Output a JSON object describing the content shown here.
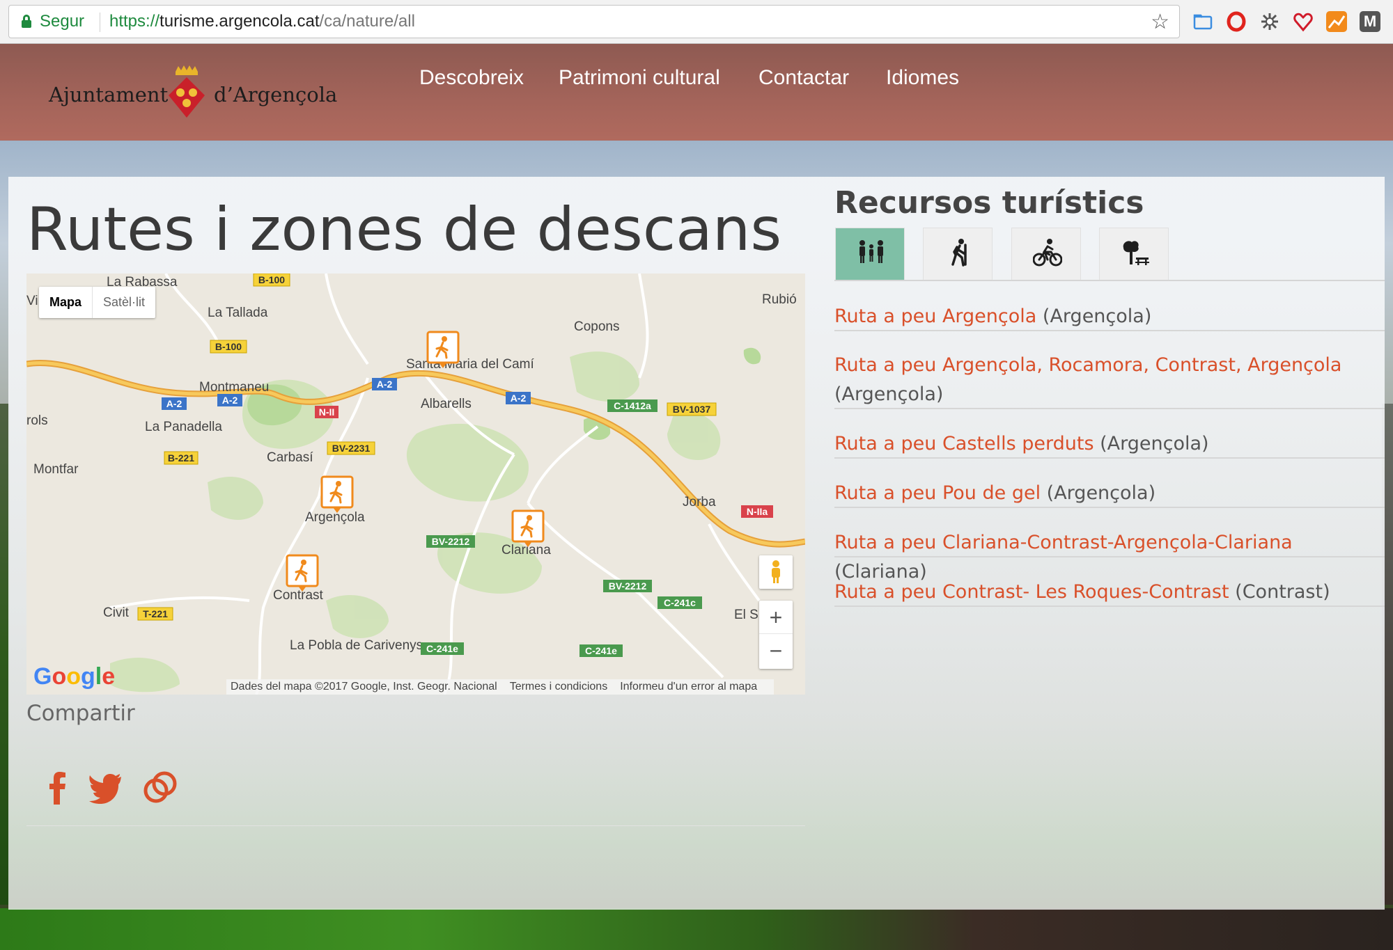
{
  "browser": {
    "secure_label": "Segur",
    "url_scheme": "https://",
    "url_host": "turisme.argencola.cat",
    "url_path": "/ca/nature/all",
    "bookmark_icon": "star-icon",
    "extensions": [
      "folder-icon",
      "opera-icon",
      "gear-icon",
      "heart-icon",
      "chart-icon",
      "gmail-icon"
    ]
  },
  "header": {
    "logo_left": "Ajuntament",
    "logo_right": "d’Argençola",
    "nav": [
      "Descobreix",
      "Patrimoni cultural",
      "Contactar",
      "Idiomes"
    ]
  },
  "page": {
    "title": "Rutes i zones de descans"
  },
  "map": {
    "type_buttons": {
      "active": "Mapa",
      "inactive": "Satèl·lit"
    },
    "labels": [
      "La Rabassa",
      "La Tallada",
      "Montmaneu",
      "La Panadella",
      "Carbasí",
      "Montfar",
      "Argençola",
      "Santa Maria del Camí",
      "Albarells",
      "Copons",
      "Rubió",
      "Jorba",
      "Clariana",
      "Contrast",
      "Civit",
      "La Pobla de Carivenys",
      "El S",
      "rols",
      "Vi"
    ],
    "road_labels": [
      "B-100",
      "B-100",
      "A-2",
      "A-2",
      "A-2",
      "A-2",
      "N-II",
      "B-221",
      "BV-2231",
      "BV-2212",
      "BV-2212",
      "C-1412a",
      "BV-1037",
      "N-IIa",
      "C-241c",
      "C-241e",
      "C-241e",
      "T-221"
    ],
    "attribution": [
      "Dades del mapa ©2017 Google, Inst. Geogr. Nacional",
      "Termes i condicions",
      "Informeu d'un error al mapa"
    ],
    "logo": "Google",
    "zoom_in": "+",
    "zoom_out": "−"
  },
  "share": {
    "title": "Compartir",
    "icons": [
      "facebook-icon",
      "twitter-icon",
      "link-icon"
    ]
  },
  "resources": {
    "title": "Recursos turístics",
    "tabs": [
      "family-icon",
      "hiker-icon",
      "cyclist-icon",
      "picnic-icon"
    ],
    "active_tab": 0,
    "routes": [
      {
        "name": "Ruta a peu Argençola",
        "place": "(Argençola)"
      },
      {
        "name": "Ruta a peu Argençola, Rocamora, Contrast, Argençola",
        "place": "(Argençola)"
      },
      {
        "name": "Ruta a peu Castells perduts",
        "place": "(Argençola)"
      },
      {
        "name": "Ruta a peu Pou de gel",
        "place": "(Argençola)"
      },
      {
        "name": "Ruta a peu Clariana-Contrast-Argençola-Clariana",
        "place": "(Clariana)"
      },
      {
        "name": "Ruta a peu Contrast- Les Roques-Contrast",
        "place": "(Contrast)"
      }
    ]
  },
  "colors": {
    "accent": "#d9502a",
    "header": "#a4645a",
    "active_tab": "#7fbfa6",
    "highway": "#f4b942"
  }
}
